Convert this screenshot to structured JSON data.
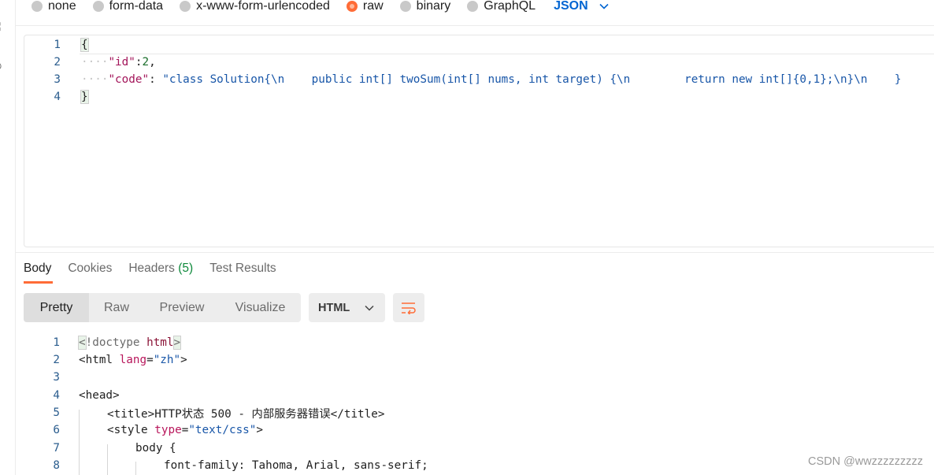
{
  "body_types": [
    {
      "label": "none",
      "selected": false
    },
    {
      "label": "form-data",
      "selected": false
    },
    {
      "label": "x-www-form-urlencoded",
      "selected": false
    },
    {
      "label": "raw",
      "selected": true
    },
    {
      "label": "binary",
      "selected": false
    },
    {
      "label": "GraphQL",
      "selected": false
    }
  ],
  "raw_format": "JSON",
  "request_body": {
    "line_numbers": [
      "1",
      "2",
      "3",
      "4"
    ],
    "line1": "{",
    "line2_key": "\"id\"",
    "line2_sep": ":",
    "line2_value": "2",
    "line2_end": ",",
    "line3_key": "\"code\"",
    "line3_sep": ": ",
    "line3_value": "\"class Solution{\\n    public int[] twoSum(int[] nums, int target) {\\n        return new int[]{0,1};\\n}\\n    }",
    "line4": "}"
  },
  "response_tabs": {
    "body": "Body",
    "cookies": "Cookies",
    "headers": "Headers",
    "headers_count": "(5)",
    "test_results": "Test Results"
  },
  "view_modes": [
    "Pretty",
    "Raw",
    "Preview",
    "Visualize"
  ],
  "active_view": "Pretty",
  "language": "HTML",
  "response_body": {
    "line_numbers": [
      "1",
      "2",
      "3",
      "4",
      "5",
      "6",
      "7",
      "8"
    ],
    "l1_open": "<",
    "l1_doctype": "!doctype",
    "l1_html": "html",
    "l1_close": ">",
    "l2_open": "<html",
    "l2_attr": "lang",
    "l2_eq": "=",
    "l2_val": "\"zh\"",
    "l2_close": ">",
    "l4": "<head>",
    "l5_open": "<title>",
    "l5_text": "HTTP状态 500 - 内部服务器错误",
    "l5_close": "</title>",
    "l6_open": "<style",
    "l6_attr": "type",
    "l6_eq": "=",
    "l6_val": "\"text/css\"",
    "l6_close": ">",
    "l7": "body {",
    "l8": "font-family: Tahoma, Arial, sans-serif;"
  },
  "watermark": "CSDN @wwzzzzzzzzz",
  "colors": {
    "accent": "#ff6c37",
    "link": "#0265d2",
    "count_green": "#0f8a3c"
  }
}
